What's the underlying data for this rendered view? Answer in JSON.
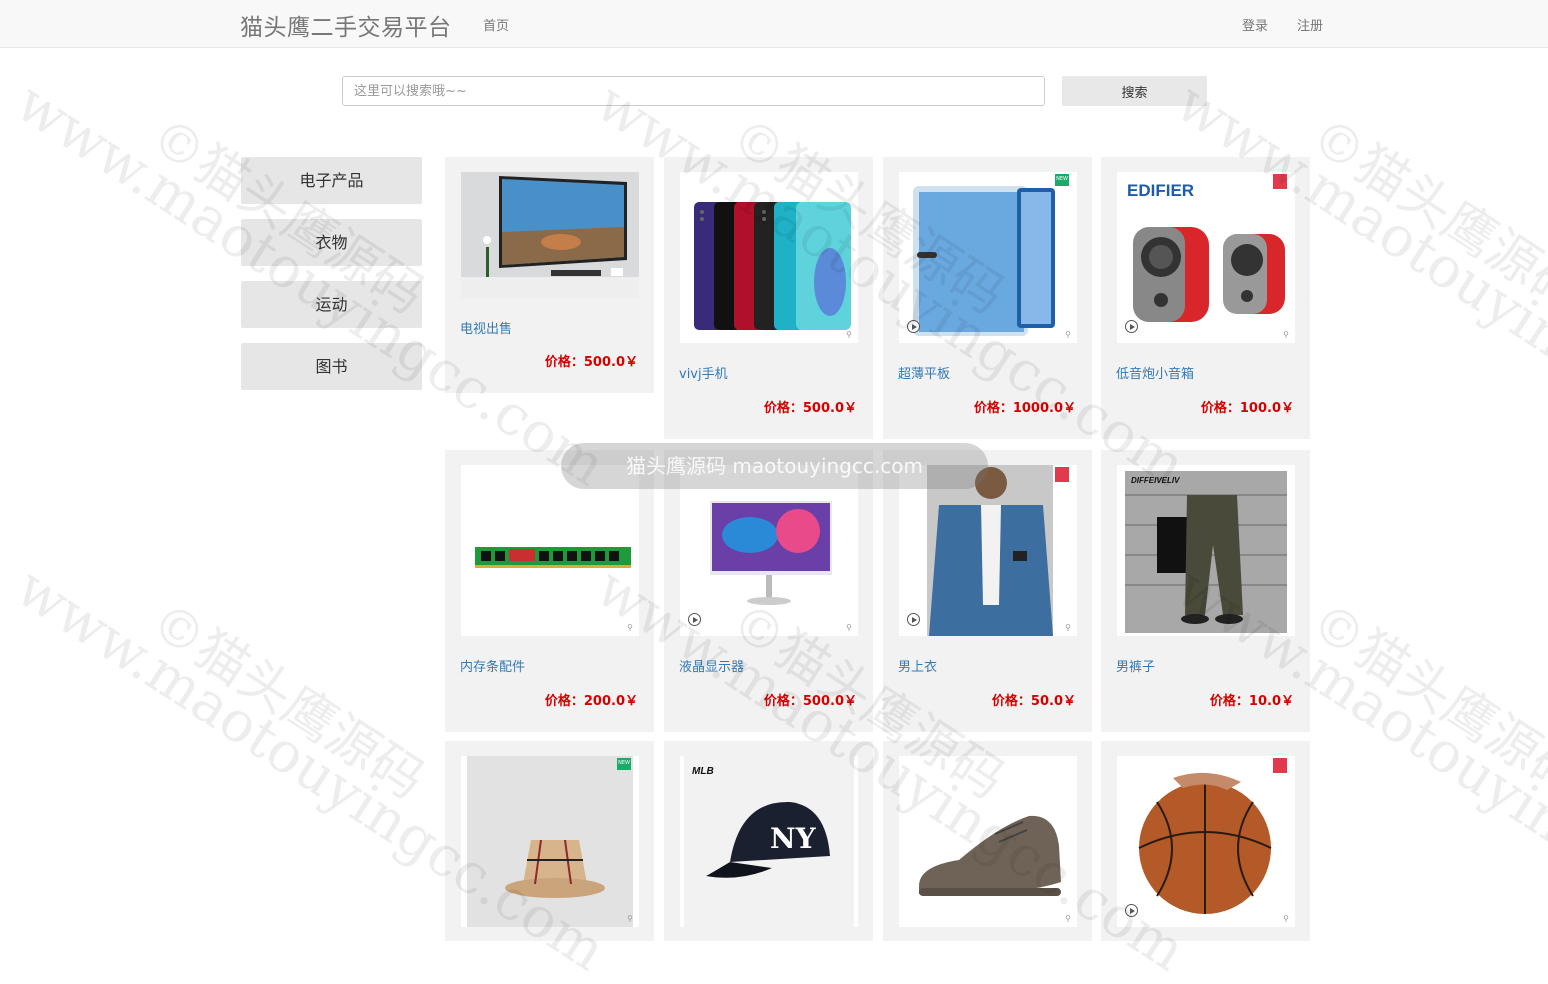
{
  "navbar": {
    "brand": "猫头鹰二手交易平台",
    "home": "首页",
    "login": "登录",
    "register": "注册"
  },
  "search": {
    "placeholder": "这里可以搜索哦~~",
    "button": "搜索"
  },
  "categories": [
    "电子产品",
    "衣物",
    "运动",
    "图书"
  ],
  "products": [
    {
      "name": "电视出售",
      "price": "价格：500.0￥"
    },
    {
      "name": "vivj手机",
      "price": "价格：500.0￥"
    },
    {
      "name": "超薄平板",
      "price": "价格：1000.0￥"
    },
    {
      "name": "低音炮小音箱",
      "price": "价格：100.0￥"
    },
    {
      "name": "内存条配件",
      "price": "价格：200.0￥"
    },
    {
      "name": "液晶显示器",
      "price": "价格：500.0￥"
    },
    {
      "name": "男上衣",
      "price": "价格：50.0￥"
    },
    {
      "name": "男裤子",
      "price": "价格：10.0￥"
    },
    {
      "name": "",
      "price": ""
    },
    {
      "name": "",
      "price": ""
    },
    {
      "name": "",
      "price": ""
    },
    {
      "name": "",
      "price": ""
    }
  ],
  "image_text": {
    "edifier": "EDIFIER",
    "mlb": "MLB",
    "pants_tag": "DIFFEIVELIV",
    "new_badge": "NEW"
  },
  "watermark": {
    "text": "www.maotouyingcc.com",
    "copyright": "©猫头鹰源码",
    "toast": "猫头鹰源码 maotouyingcc.com"
  },
  "colors": {
    "link": "#337ab7",
    "price": "#d50000",
    "navbar_bg": "#f8f8f8",
    "card_bg": "#f2f2f2"
  }
}
